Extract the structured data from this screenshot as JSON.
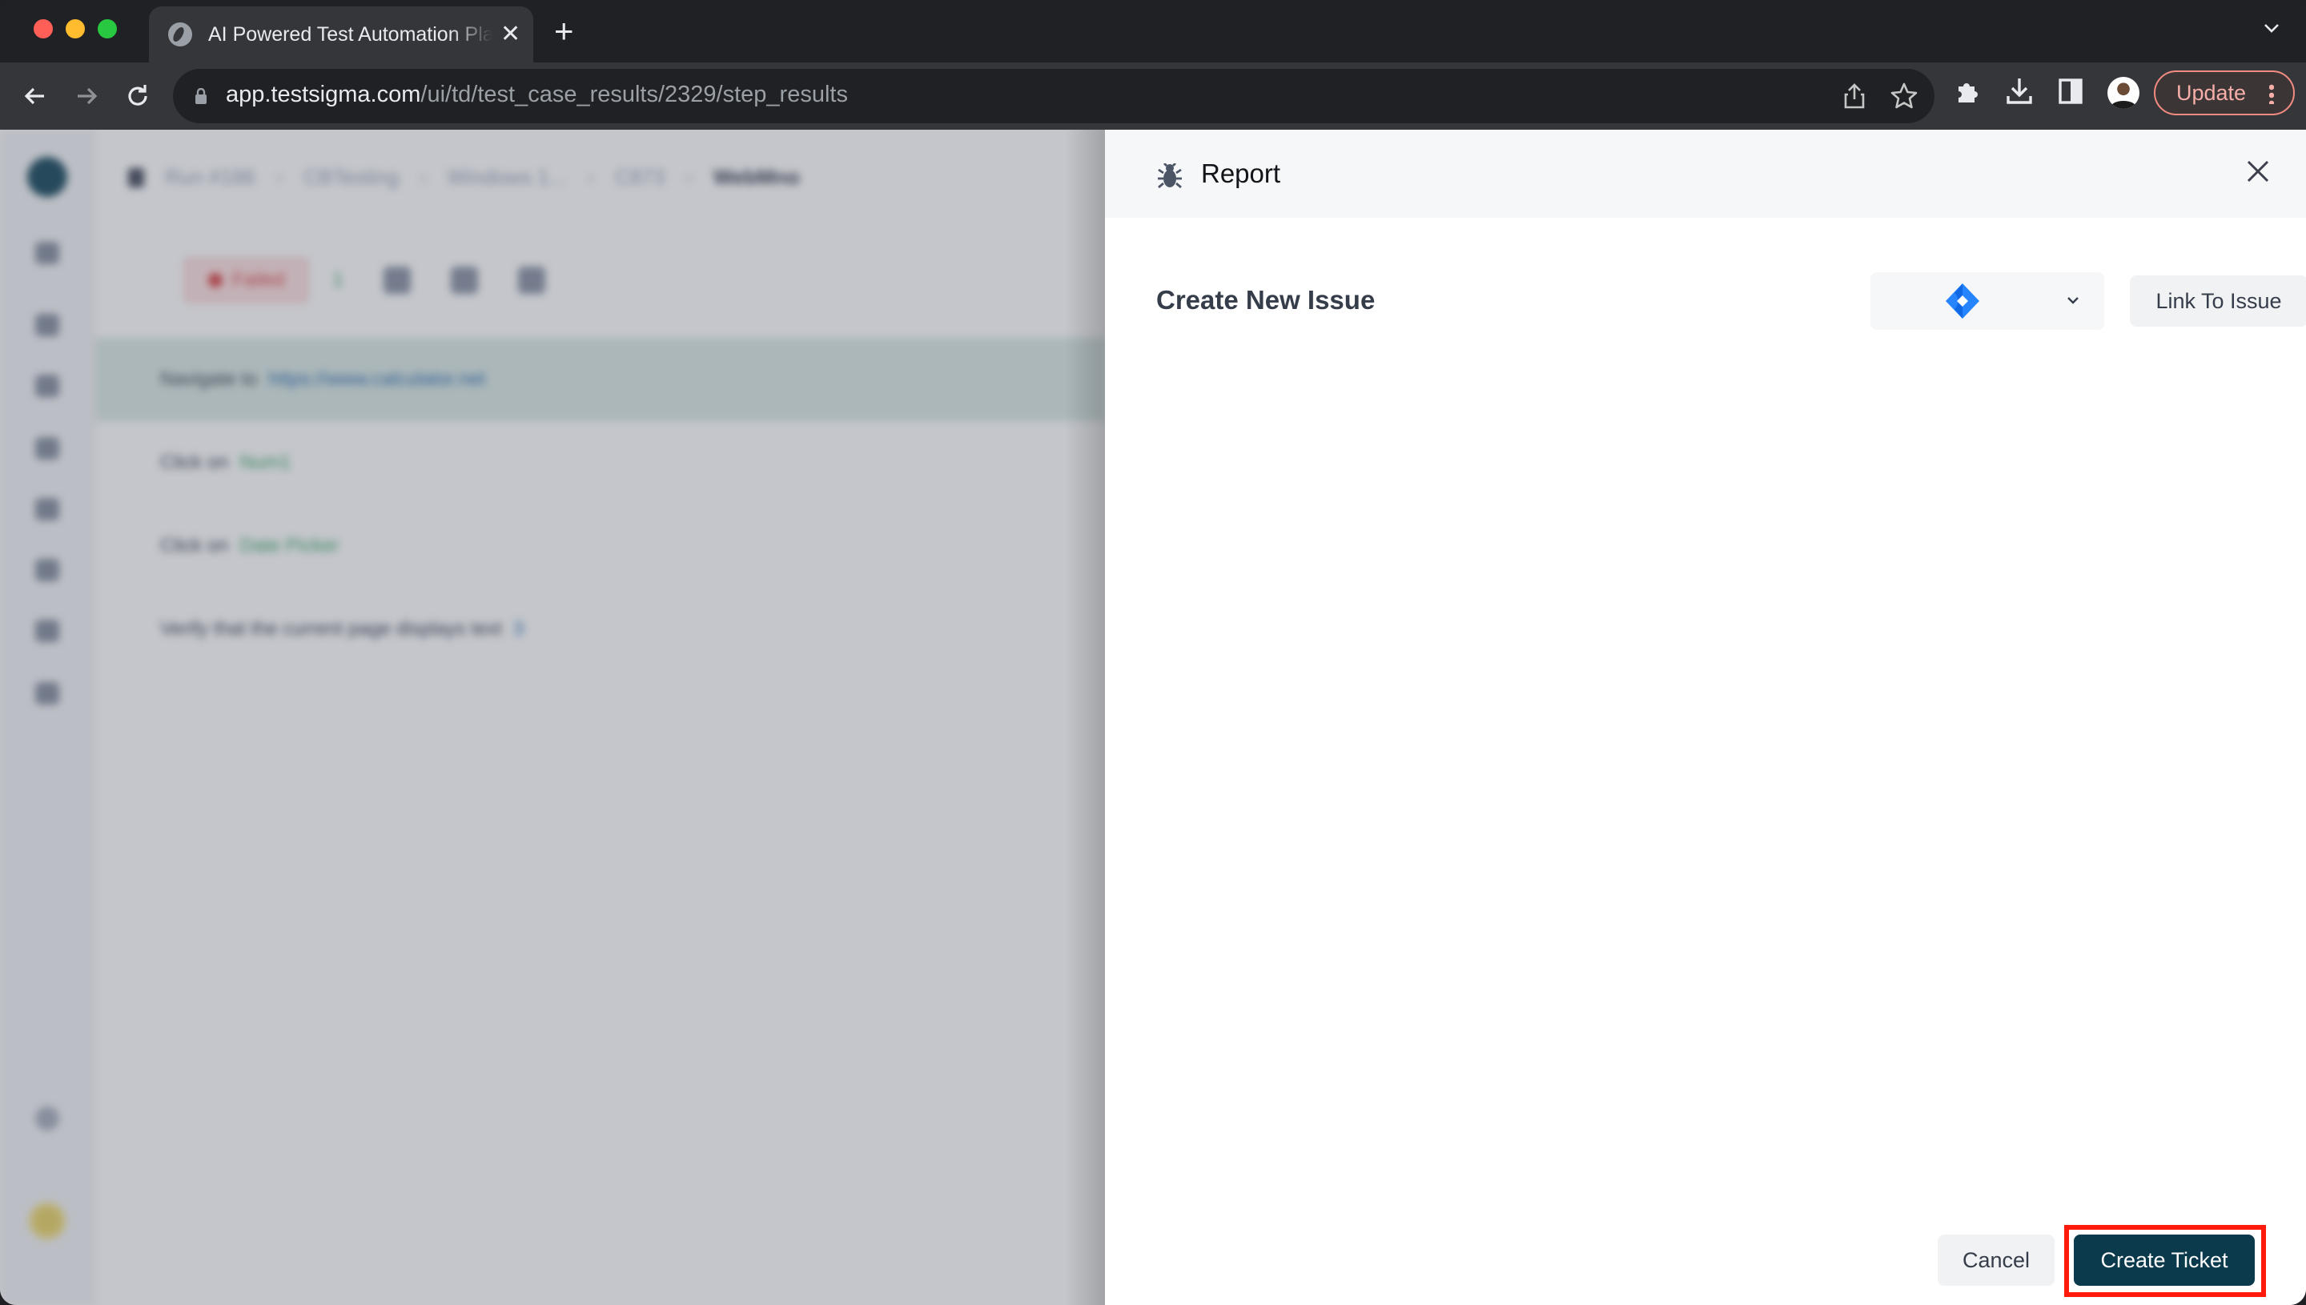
{
  "browser": {
    "tab": {
      "title": "AI Powered Test Automation Platform",
      "favicon": "globe-icon",
      "close_icon": "close-icon"
    },
    "new_tab_icon": "plus-icon",
    "address": {
      "host": "app.testsigma.com",
      "path": "/ui/td/test_case_results/2329/step_results",
      "lock_icon": "lock-icon"
    },
    "toolbar_icons": [
      "back-icon",
      "forward-icon",
      "reload-icon",
      "share-icon",
      "star-icon",
      "extensions-icon",
      "download-icon",
      "side-panel-icon",
      "profile-avatar",
      "menu-icon"
    ],
    "update_label": "Update",
    "accent_color": "#f28b82"
  },
  "background_page": {
    "breadcrumb": [
      "Run #186",
      "CBTesting",
      "Windows 1...",
      "C873",
      "WebMno"
    ],
    "status": {
      "failed_label": "Failed",
      "passed_count": "1",
      "failed_color": "#d94848",
      "passed_color": "#3fa46a"
    },
    "steps": [
      {
        "action": "Navigate to",
        "target": "https://www.calculator.net",
        "target_type": "link",
        "active": true
      },
      {
        "action": "Click on",
        "target": "Num1",
        "target_type": "element",
        "active": false
      },
      {
        "action": "Click on",
        "target": "Date Picker",
        "target_type": "element",
        "active": false
      },
      {
        "action": "Verify that the current page displays text",
        "target": "3",
        "target_type": "link",
        "active": false
      }
    ]
  },
  "drawer": {
    "title": "Report",
    "title_icon": "bug-icon",
    "close_icon": "close-icon",
    "section_label": "Create New Issue",
    "tracker_select": {
      "selected": "Jira",
      "icon": "jira-icon",
      "jira_color": "#2684ff"
    },
    "link_to_issue_label": "Link To Issue",
    "footer": {
      "cancel_label": "Cancel",
      "create_ticket_label": "Create Ticket",
      "create_ticket_color": "#0b3a4d",
      "highlight_color": "#ff1a0a"
    }
  }
}
